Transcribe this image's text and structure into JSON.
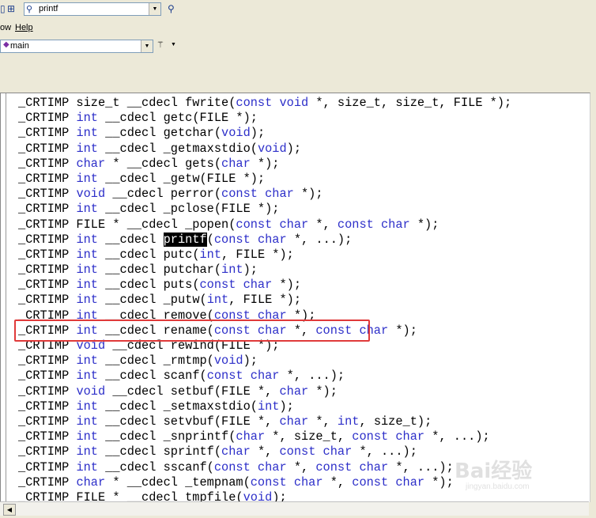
{
  "toolbar": {
    "find_value": "printf"
  },
  "menubar": {
    "items": [
      "ow",
      "Help"
    ]
  },
  "function_selector": {
    "value": "main"
  },
  "editor": {
    "lines": [
      [
        {
          "t": "_CRTIMP size_t __cdecl fwrite("
        },
        {
          "t": "const void",
          "k": 1
        },
        {
          "t": " *, size_t, size_t, FILE *);"
        }
      ],
      [
        {
          "t": "_CRTIMP "
        },
        {
          "t": "int",
          "k": 1
        },
        {
          "t": " __cdecl getc(FILE *);"
        }
      ],
      [
        {
          "t": "_CRTIMP "
        },
        {
          "t": "int",
          "k": 1
        },
        {
          "t": " __cdecl getchar("
        },
        {
          "t": "void",
          "k": 1
        },
        {
          "t": ");"
        }
      ],
      [
        {
          "t": "_CRTIMP "
        },
        {
          "t": "int",
          "k": 1
        },
        {
          "t": " __cdecl _getmaxstdio("
        },
        {
          "t": "void",
          "k": 1
        },
        {
          "t": ");"
        }
      ],
      [
        {
          "t": "_CRTIMP "
        },
        {
          "t": "char",
          "k": 1
        },
        {
          "t": " * __cdecl gets("
        },
        {
          "t": "char",
          "k": 1
        },
        {
          "t": " *);"
        }
      ],
      [
        {
          "t": "_CRTIMP "
        },
        {
          "t": "int",
          "k": 1
        },
        {
          "t": " __cdecl _getw(FILE *);"
        }
      ],
      [
        {
          "t": "_CRTIMP "
        },
        {
          "t": "void",
          "k": 1
        },
        {
          "t": " __cdecl perror("
        },
        {
          "t": "const char",
          "k": 1
        },
        {
          "t": " *);"
        }
      ],
      [
        {
          "t": "_CRTIMP "
        },
        {
          "t": "int",
          "k": 1
        },
        {
          "t": " __cdecl _pclose(FILE *);"
        }
      ],
      [
        {
          "t": "_CRTIMP FILE * __cdecl _popen("
        },
        {
          "t": "const char",
          "k": 1
        },
        {
          "t": " *, "
        },
        {
          "t": "const char",
          "k": 1
        },
        {
          "t": " *);"
        }
      ],
      [
        {
          "t": "_CRTIMP "
        },
        {
          "t": "int",
          "k": 1
        },
        {
          "t": " __cdecl "
        },
        {
          "t": "printf",
          "h": 1
        },
        {
          "t": "("
        },
        {
          "t": "const char",
          "k": 1
        },
        {
          "t": " *, ...);"
        }
      ],
      [
        {
          "t": "_CRTIMP "
        },
        {
          "t": "int",
          "k": 1
        },
        {
          "t": " __cdecl putc("
        },
        {
          "t": "int",
          "k": 1
        },
        {
          "t": ", FILE *);"
        }
      ],
      [
        {
          "t": "_CRTIMP "
        },
        {
          "t": "int",
          "k": 1
        },
        {
          "t": " __cdecl putchar("
        },
        {
          "t": "int",
          "k": 1
        },
        {
          "t": ");"
        }
      ],
      [
        {
          "t": "_CRTIMP "
        },
        {
          "t": "int",
          "k": 1
        },
        {
          "t": " __cdecl puts("
        },
        {
          "t": "const char",
          "k": 1
        },
        {
          "t": " *);"
        }
      ],
      [
        {
          "t": "_CRTIMP "
        },
        {
          "t": "int",
          "k": 1
        },
        {
          "t": " __cdecl _putw("
        },
        {
          "t": "int",
          "k": 1
        },
        {
          "t": ", FILE *);"
        }
      ],
      [
        {
          "t": "_CRTIMP "
        },
        {
          "t": "int",
          "k": 1
        },
        {
          "t": " __cdecl remove("
        },
        {
          "t": "const char",
          "k": 1
        },
        {
          "t": " *);"
        }
      ],
      [
        {
          "t": "_CRTIMP "
        },
        {
          "t": "int",
          "k": 1
        },
        {
          "t": " __cdecl rename("
        },
        {
          "t": "const char",
          "k": 1
        },
        {
          "t": " *, "
        },
        {
          "t": "const char",
          "k": 1
        },
        {
          "t": " *);"
        }
      ],
      [
        {
          "t": "_CRTIMP "
        },
        {
          "t": "void",
          "k": 1
        },
        {
          "t": " __cdecl rewind(FILE *);"
        }
      ],
      [
        {
          "t": "_CRTIMP "
        },
        {
          "t": "int",
          "k": 1
        },
        {
          "t": " __cdecl _rmtmp("
        },
        {
          "t": "void",
          "k": 1
        },
        {
          "t": ");"
        }
      ],
      [
        {
          "t": "_CRTIMP "
        },
        {
          "t": "int",
          "k": 1
        },
        {
          "t": " __cdecl scanf("
        },
        {
          "t": "const char",
          "k": 1
        },
        {
          "t": " *, ...);"
        }
      ],
      [
        {
          "t": "_CRTIMP "
        },
        {
          "t": "void",
          "k": 1
        },
        {
          "t": " __cdecl setbuf(FILE *, "
        },
        {
          "t": "char",
          "k": 1
        },
        {
          "t": " *);"
        }
      ],
      [
        {
          "t": "_CRTIMP "
        },
        {
          "t": "int",
          "k": 1
        },
        {
          "t": " __cdecl _setmaxstdio("
        },
        {
          "t": "int",
          "k": 1
        },
        {
          "t": ");"
        }
      ],
      [
        {
          "t": "_CRTIMP "
        },
        {
          "t": "int",
          "k": 1
        },
        {
          "t": " __cdecl setvbuf(FILE *, "
        },
        {
          "t": "char",
          "k": 1
        },
        {
          "t": " *, "
        },
        {
          "t": "int",
          "k": 1
        },
        {
          "t": ", size_t);"
        }
      ],
      [
        {
          "t": "_CRTIMP "
        },
        {
          "t": "int",
          "k": 1
        },
        {
          "t": " __cdecl _snprintf("
        },
        {
          "t": "char",
          "k": 1
        },
        {
          "t": " *, size_t, "
        },
        {
          "t": "const char",
          "k": 1
        },
        {
          "t": " *, ...);"
        }
      ],
      [
        {
          "t": "_CRTIMP "
        },
        {
          "t": "int",
          "k": 1
        },
        {
          "t": " __cdecl sprintf("
        },
        {
          "t": "char",
          "k": 1
        },
        {
          "t": " *, "
        },
        {
          "t": "const char",
          "k": 1
        },
        {
          "t": " *, ...);"
        }
      ],
      [
        {
          "t": "_CRTIMP "
        },
        {
          "t": "int",
          "k": 1
        },
        {
          "t": " __cdecl sscanf("
        },
        {
          "t": "const char",
          "k": 1
        },
        {
          "t": " *, "
        },
        {
          "t": "const char",
          "k": 1
        },
        {
          "t": " *, ...);"
        }
      ],
      [
        {
          "t": "_CRTIMP "
        },
        {
          "t": "char",
          "k": 1
        },
        {
          "t": " * __cdecl _tempnam("
        },
        {
          "t": "const char",
          "k": 1
        },
        {
          "t": " *, "
        },
        {
          "t": "const char",
          "k": 1
        },
        {
          "t": " *);"
        }
      ],
      [
        {
          "t": "_CRTIMP FILE * __cdecl tmpfile("
        },
        {
          "t": "void",
          "k": 1
        },
        {
          "t": ");"
        }
      ]
    ]
  },
  "watermark": {
    "brand": "Bai",
    "brand2": "经验",
    "url": "jingyan.baidu.com"
  },
  "colors": {
    "keyword": "#2d2fc9",
    "highlight_bg": "#000000",
    "callout_border": "#e03a3a"
  }
}
